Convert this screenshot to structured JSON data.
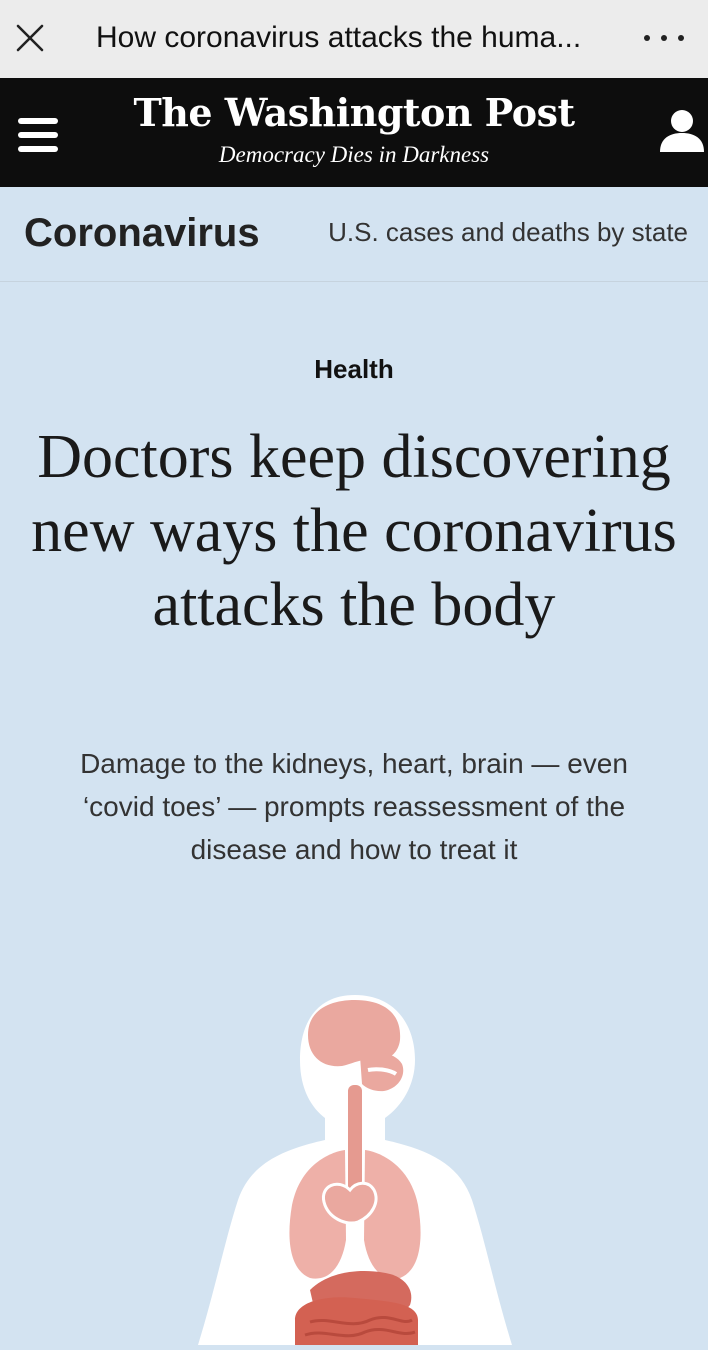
{
  "browser": {
    "tab_title": "How coronavirus attacks the huma...",
    "close_icon": "close-icon",
    "more_icon": "more-options-icon"
  },
  "masthead": {
    "logo": "The Washington Post",
    "tagline": "Democracy Dies in Darkness",
    "menu_icon": "hamburger-menu-icon",
    "user_icon": "user-account-icon",
    "background": "#0d0d0d"
  },
  "section": {
    "title": "Coronavirus",
    "link": "U.S. cases and deaths by state"
  },
  "article": {
    "kicker": "Health",
    "headline": "Doctors keep discovering new ways the coronavirus attacks the body",
    "dek": "Damage to the kidneys, heart, brain — even ‘covid toes’ — prompts reassessment of the disease and how to treat it",
    "background": "#d3e3f1",
    "illustration_icon": "human-body-organs-illustration"
  }
}
